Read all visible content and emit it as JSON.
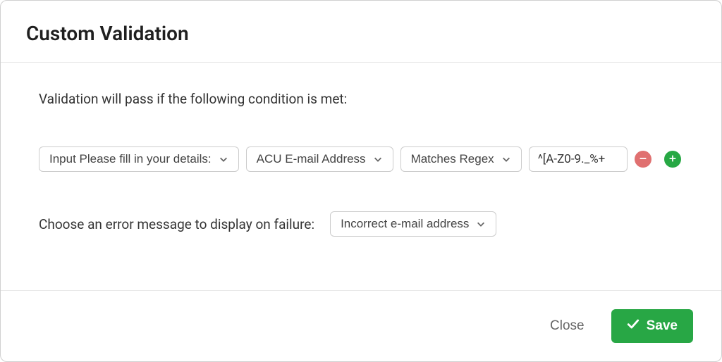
{
  "header": {
    "title": "Custom Validation"
  },
  "body": {
    "description": "Validation will pass if the following condition is met:",
    "condition": {
      "source_select": "Input Please fill in your details:",
      "field_select": "ACU E-mail Address",
      "operator_select": "Matches Regex",
      "value_input": "^[A-Z0-9._%+"
    },
    "error_label": "Choose an error message to display on failure:",
    "error_select": "Incorrect e-mail address"
  },
  "footer": {
    "close_label": "Close",
    "save_label": "Save"
  },
  "colors": {
    "accent_green": "#28a745",
    "remove_red": "#e07070"
  }
}
